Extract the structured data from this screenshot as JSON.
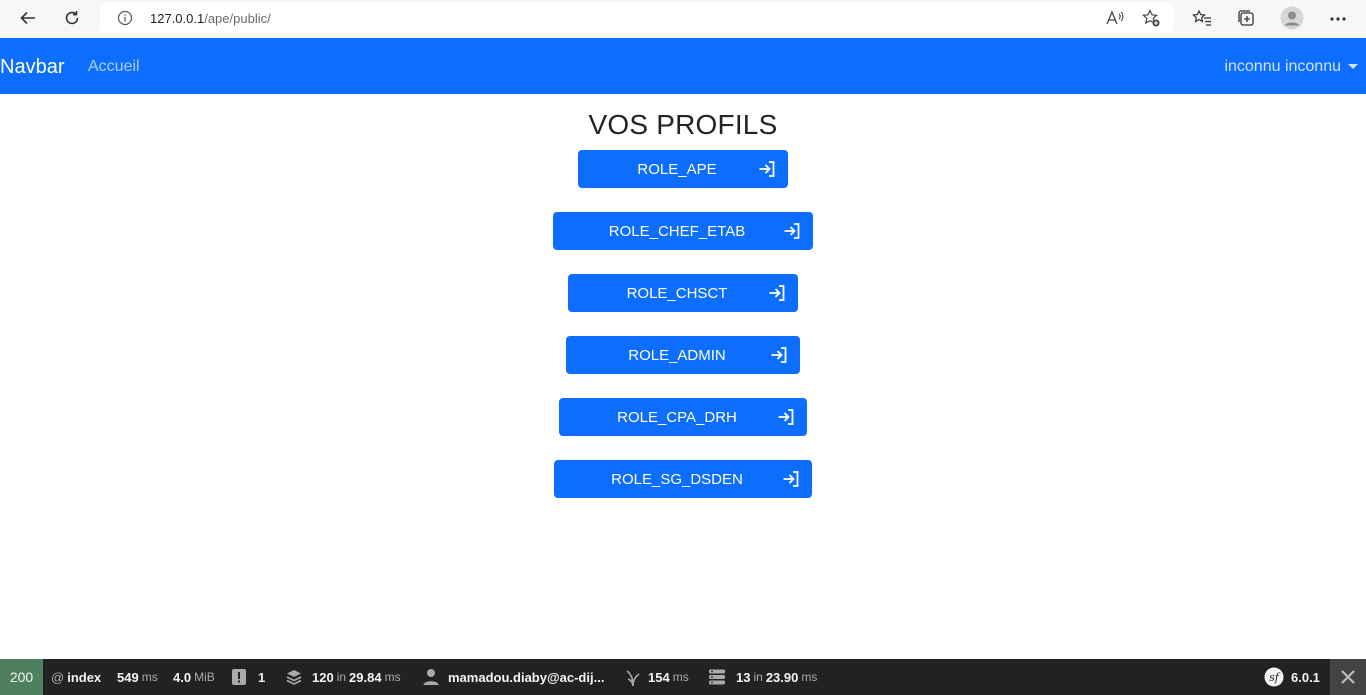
{
  "browser": {
    "url_host": "127.0.0.1",
    "url_path": "/ape/public/"
  },
  "navbar": {
    "brand": "Navbar",
    "links": [
      {
        "label": "Accueil"
      }
    ],
    "user": "inconnu inconnu"
  },
  "main": {
    "title": "VOS PROFILS",
    "roles": [
      {
        "label": "ROLE_APE"
      },
      {
        "label": "ROLE_CHEF_ETAB"
      },
      {
        "label": "ROLE_CHSCT"
      },
      {
        "label": "ROLE_ADMIN"
      },
      {
        "label": "ROLE_CPA_DRH"
      },
      {
        "label": "ROLE_SG_DSDEN"
      }
    ]
  },
  "toolbar": {
    "status": "200",
    "route_prefix": "@",
    "route": "index",
    "time": "549",
    "time_unit": "ms",
    "memory": "4.0",
    "memory_unit": "MiB",
    "logs": "1",
    "cache": "120",
    "cache_in": "in",
    "cache_time": "29.84",
    "cache_unit": "ms",
    "user": "mamadou.diaby@ac-dij...",
    "twig_time": "154",
    "twig_unit": "ms",
    "db_queries": "13",
    "db_in": "in",
    "db_time": "23.90",
    "db_unit": "ms",
    "symfony_version": "6.0.1"
  },
  "colors": {
    "primary": "#0d6efd",
    "toolbar_bg": "#222222",
    "status_ok": "#4f805d"
  }
}
